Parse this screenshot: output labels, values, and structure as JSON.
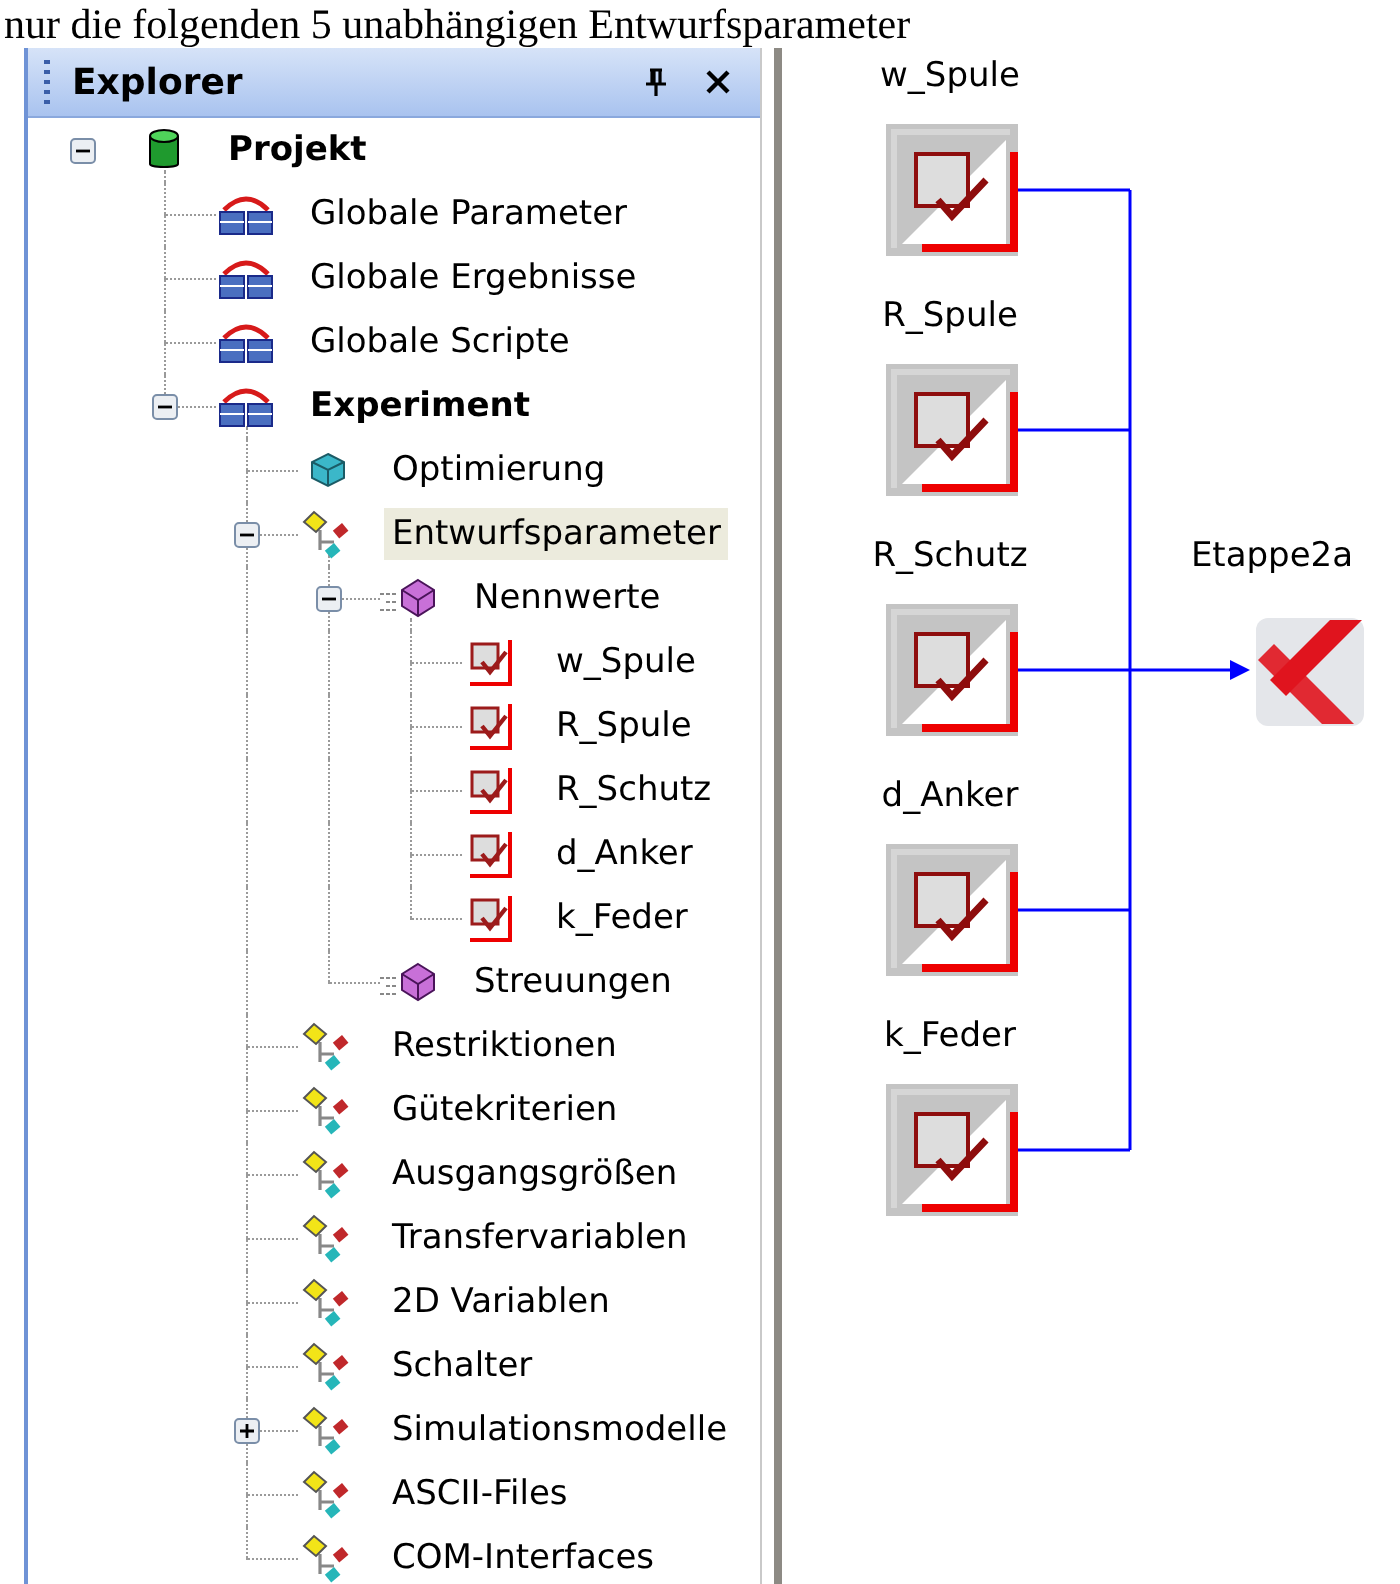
{
  "document_text": "nur die folgenden 5 unabhängigen Entwurfsparameter",
  "explorer": {
    "title": "Explorer",
    "tree": [
      {
        "label": "Projekt",
        "kind": "database",
        "bold": true,
        "expanded": true,
        "selected": false,
        "children": [
          {
            "label": "Globale Parameter",
            "kind": "table",
            "selected": false
          },
          {
            "label": "Globale Ergebnisse",
            "kind": "table",
            "selected": false
          },
          {
            "label": "Globale Scripte",
            "kind": "table",
            "selected": false
          },
          {
            "label": "Experiment",
            "kind": "table",
            "bold": true,
            "expanded": true,
            "selected": false,
            "children": [
              {
                "label": "Optimierung",
                "kind": "cube",
                "selected": false
              },
              {
                "label": "Entwurfsparameter",
                "kind": "branch",
                "expanded": true,
                "selected": true,
                "children": [
                  {
                    "label": "Nennwerte",
                    "kind": "group",
                    "expanded": true,
                    "selected": false,
                    "children": [
                      {
                        "label": "w_Spule",
                        "kind": "param",
                        "selected": false
                      },
                      {
                        "label": "R_Spule",
                        "kind": "param",
                        "selected": false
                      },
                      {
                        "label": "R_Schutz",
                        "kind": "param",
                        "selected": false
                      },
                      {
                        "label": "d_Anker",
                        "kind": "param",
                        "selected": false
                      },
                      {
                        "label": "k_Feder",
                        "kind": "param",
                        "selected": false
                      }
                    ]
                  },
                  {
                    "label": "Streuungen",
                    "kind": "group",
                    "selected": false
                  }
                ]
              },
              {
                "label": "Restriktionen",
                "kind": "branch",
                "selected": false
              },
              {
                "label": "Gütekriterien",
                "kind": "branch",
                "selected": false
              },
              {
                "label": "Ausgangsgrößen",
                "kind": "branch",
                "selected": false
              },
              {
                "label": "Transfervariablen",
                "kind": "branch",
                "selected": false
              },
              {
                "label": "2D Variablen",
                "kind": "branch",
                "selected": false
              },
              {
                "label": "Schalter",
                "kind": "branch",
                "selected": false
              },
              {
                "label": "Simulationsmodelle",
                "kind": "branch",
                "expanded": false,
                "selected": false
              },
              {
                "label": "ASCII-Files",
                "kind": "branch",
                "selected": false
              },
              {
                "label": "COM-Interfaces",
                "kind": "branch",
                "selected": false
              }
            ]
          }
        ]
      }
    ]
  },
  "diagram": {
    "inputs": [
      {
        "label": "w_Spule",
        "kind": "param"
      },
      {
        "label": "R_Spule",
        "kind": "param"
      },
      {
        "label": "R_Schutz",
        "kind": "param"
      },
      {
        "label": "d_Anker",
        "kind": "param"
      },
      {
        "label": "k_Feder",
        "kind": "param"
      }
    ],
    "target": {
      "label": "Etappe2a",
      "kind": "stage"
    }
  }
}
